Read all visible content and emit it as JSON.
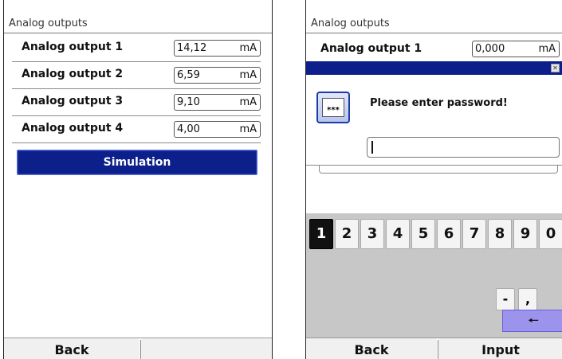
{
  "left": {
    "title": "Analog outputs",
    "rows": [
      {
        "label": "Analog output 1",
        "value": "14,12",
        "unit": "mA"
      },
      {
        "label": "Analog output 2",
        "value": "6,59",
        "unit": "mA"
      },
      {
        "label": "Analog output 3",
        "value": "9,10",
        "unit": "mA"
      },
      {
        "label": "Analog output 4",
        "value": "4,00",
        "unit": "mA"
      }
    ],
    "simulation_label": "Simulation",
    "footer": {
      "back": "Back",
      "right": ""
    }
  },
  "right": {
    "title": "Analog outputs",
    "row": {
      "label": "Analog output 1",
      "value": "0,000",
      "unit": "mA"
    },
    "dialog": {
      "close_glyph": "✕",
      "icon_text": "***",
      "message": "Please enter password!",
      "input_value": ""
    },
    "keyboard": {
      "digits": [
        "1",
        "2",
        "3",
        "4",
        "5",
        "6",
        "7",
        "8",
        "9",
        "0"
      ],
      "minus": "-",
      "comma": ",",
      "backspace": "🠔"
    },
    "footer": {
      "back": "Back",
      "input": "Input"
    }
  }
}
